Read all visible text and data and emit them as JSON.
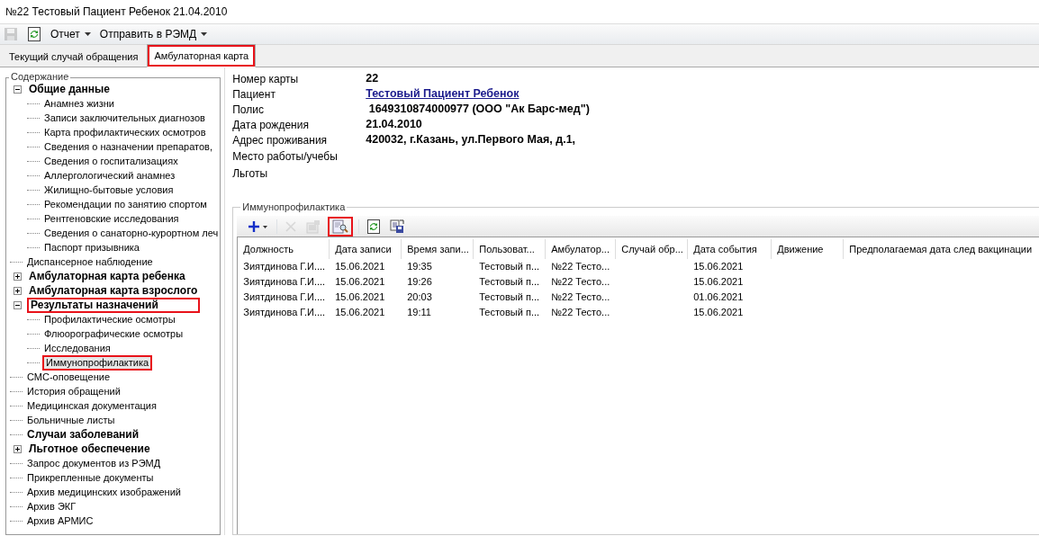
{
  "window": {
    "title": "№22 Тестовый Пациент Ребенок 21.04.2010"
  },
  "toolbar": {
    "icons": [
      {
        "kind": "save",
        "disabled": true
      },
      {
        "kind": "refresh",
        "disabled": false
      }
    ],
    "menus": [
      {
        "label": "Отчет"
      },
      {
        "label": "Отправить в РЭМД"
      }
    ]
  },
  "tabs": [
    {
      "label": "Текущий случай обращения",
      "selected": false,
      "highlighted": false
    },
    {
      "label": "Амбулаторная карта",
      "selected": true,
      "highlighted": true
    }
  ],
  "sidebar": {
    "title": "Содержание",
    "items": [
      {
        "label": "Общие данные",
        "bold": true,
        "expanded": true,
        "highlighted": false,
        "selected": false,
        "children": [
          {
            "label": "Анамнез жизни",
            "bold": false,
            "highlighted": false,
            "selected": false
          },
          {
            "label": "Записи заключительных диагнозов",
            "bold": false,
            "highlighted": false,
            "selected": false
          },
          {
            "label": "Карта профилактических осмотров",
            "bold": false,
            "highlighted": false,
            "selected": false
          },
          {
            "label": "Сведения о назначении препаратов,",
            "bold": false,
            "highlighted": false,
            "selected": false
          },
          {
            "label": "Сведения о госпитализациях",
            "bold": false,
            "highlighted": false,
            "selected": false
          },
          {
            "label": "Аллергологический анамнез",
            "bold": false,
            "highlighted": false,
            "selected": false
          },
          {
            "label": "Жилищно-бытовые условия",
            "bold": false,
            "highlighted": false,
            "selected": false
          },
          {
            "label": "Рекомендации по занятию спортом",
            "bold": false,
            "highlighted": false,
            "selected": false
          },
          {
            "label": "Рентгеновские исследования",
            "bold": false,
            "highlighted": false,
            "selected": false
          },
          {
            "label": "Сведения о санаторно-курортном леч",
            "bold": false,
            "highlighted": false,
            "selected": false
          },
          {
            "label": "Паспорт призывника",
            "bold": false,
            "highlighted": false,
            "selected": false
          }
        ]
      },
      {
        "label": "Диспансерное наблюдение",
        "bold": false,
        "highlighted": false,
        "selected": false
      },
      {
        "label": "Амбулаторная карта ребенка",
        "bold": true,
        "expanded": false,
        "highlighted": false,
        "selected": false
      },
      {
        "label": "Амбулаторная карта взрослого",
        "bold": true,
        "expanded": false,
        "highlighted": false,
        "selected": false
      },
      {
        "label": "Результаты назначений",
        "bold": true,
        "expanded": true,
        "highlighted": true,
        "selected": false,
        "children": [
          {
            "label": "Профилактические осмотры",
            "bold": false,
            "highlighted": false,
            "selected": false
          },
          {
            "label": "Флюорографические осмотры",
            "bold": false,
            "highlighted": false,
            "selected": false
          },
          {
            "label": "Исследования",
            "bold": false,
            "highlighted": false,
            "selected": false
          },
          {
            "label": "Иммунопрофилактика",
            "bold": false,
            "highlighted": true,
            "selected": true
          }
        ]
      },
      {
        "label": "СМС-оповещение",
        "bold": false,
        "highlighted": false,
        "selected": false
      },
      {
        "label": "История обращений",
        "bold": false,
        "highlighted": false,
        "selected": false
      },
      {
        "label": "Медицинская документация",
        "bold": false,
        "highlighted": false,
        "selected": false
      },
      {
        "label": "Больничные листы",
        "bold": false,
        "highlighted": false,
        "selected": false
      },
      {
        "label": "Случаи заболеваний",
        "bold": true,
        "highlighted": false,
        "selected": false
      },
      {
        "label": "Льготное обеспечение",
        "bold": true,
        "expanded": false,
        "highlighted": false,
        "selected": false
      },
      {
        "label": "Запрос документов из РЭМД",
        "bold": false,
        "highlighted": false,
        "selected": false
      },
      {
        "label": "Прикрепленные документы",
        "bold": false,
        "highlighted": false,
        "selected": false
      },
      {
        "label": "Архив медицинских изображений",
        "bold": false,
        "highlighted": false,
        "selected": false
      },
      {
        "label": "Архив ЭКГ",
        "bold": false,
        "highlighted": false,
        "selected": false
      },
      {
        "label": "Архив АРМИС",
        "bold": false,
        "highlighted": false,
        "selected": false
      }
    ]
  },
  "patient": [
    {
      "label": "Номер карты",
      "value": "22",
      "kind": "text"
    },
    {
      "label": "Пациент",
      "value": "Тестовый Пациент Ребенок",
      "kind": "link"
    },
    {
      "label": "Полис",
      "value": " 1649310874000977 (ООО \"Ак Барс-мед\")",
      "kind": "text"
    },
    {
      "label": "Дата рождения",
      "value": "21.04.2010",
      "kind": "text"
    },
    {
      "label": "Адрес проживания",
      "value": "420032, г.Казань, ул.Первого Мая, д.1,",
      "kind": "text"
    },
    {
      "label": "Место работы/учебы"
    },
    {
      "label": "Льготы"
    }
  ],
  "panel": {
    "title": "Иммунопрофилактика",
    "toolbar": [
      {
        "kind": "add",
        "disabled": false,
        "highlighted": false
      },
      {
        "kind": "delete",
        "disabled": true,
        "highlighted": false
      },
      {
        "kind": "properties",
        "disabled": true,
        "highlighted": false
      },
      {
        "kind": "find",
        "disabled": false,
        "highlighted": true
      },
      {
        "kind": "refresh",
        "disabled": false,
        "highlighted": false
      },
      {
        "kind": "export",
        "disabled": false,
        "highlighted": false
      }
    ],
    "table": {
      "columns": [
        "Должность",
        "Дата записи",
        "Время запи...",
        "Пользоват...",
        "Амбулатор...",
        "Случай обр...",
        "Дата события",
        "Движение",
        "Предполагаемая дата след вакцинации"
      ],
      "rows": [
        [
          "Зиятдинова Г.И....",
          "15.06.2021",
          "19:35",
          "Тестовый п...",
          "№22 Тесто...",
          "",
          "15.06.2021",
          "",
          ""
        ],
        [
          "Зиятдинова Г.И....",
          "15.06.2021",
          "19:26",
          "Тестовый п...",
          "№22 Тесто...",
          "",
          "15.06.2021",
          "",
          ""
        ],
        [
          "Зиятдинова Г.И....",
          "15.06.2021",
          "20:03",
          "Тестовый п...",
          "№22 Тесто...",
          "",
          "01.06.2021",
          "",
          ""
        ],
        [
          "Зиятдинова Г.И....",
          "15.06.2021",
          "19:11",
          "Тестовый п...",
          "№22 Тесто...",
          "",
          "15.06.2021",
          "",
          ""
        ]
      ]
    }
  }
}
